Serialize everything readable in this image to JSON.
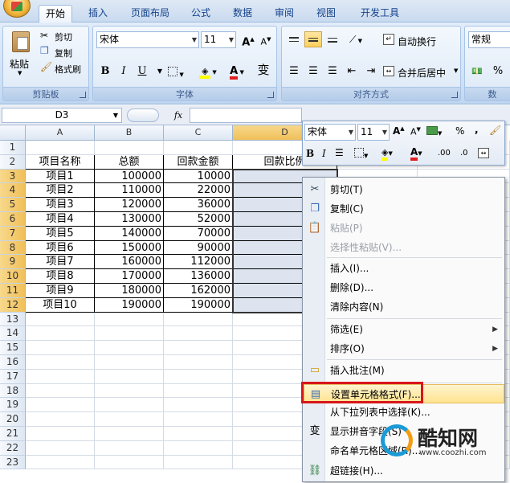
{
  "tabs": [
    "开始",
    "插入",
    "页面布局",
    "公式",
    "数据",
    "审阅",
    "视图",
    "开发工具"
  ],
  "ribbon": {
    "clipboard": {
      "label": "剪贴板",
      "paste": "粘贴",
      "cut": "剪切",
      "copy": "复制",
      "format_painter": "格式刷"
    },
    "font": {
      "label": "字体",
      "name": "宋体",
      "size": "11",
      "bold": "B",
      "italic": "I",
      "underline": "U",
      "grow": "A",
      "shrink": "A",
      "font_color": "A",
      "phonetic": "变"
    },
    "alignment": {
      "label": "对齐方式",
      "wrap": "自动换行",
      "merge": "合并后居中"
    },
    "number": {
      "label": "数",
      "format": "常规",
      "percent": "%"
    }
  },
  "formula_bar": {
    "name_box": "D3",
    "fx": "fx"
  },
  "columns": [
    "A",
    "B",
    "C",
    "D"
  ],
  "rows": [
    "1",
    "2",
    "3",
    "4",
    "5",
    "6",
    "7",
    "8",
    "9",
    "10",
    "11",
    "12",
    "13",
    "14",
    "15",
    "16",
    "17",
    "18",
    "19",
    "20",
    "21",
    "22",
    "23"
  ],
  "table": {
    "headers": [
      "项目名称",
      "总额",
      "回款金额",
      "回款比例"
    ],
    "data": [
      [
        "项目1",
        "100000",
        "10000"
      ],
      [
        "项目2",
        "110000",
        "22000"
      ],
      [
        "项目3",
        "120000",
        "36000"
      ],
      [
        "项目4",
        "130000",
        "52000"
      ],
      [
        "项目5",
        "140000",
        "70000"
      ],
      [
        "项目6",
        "150000",
        "90000"
      ],
      [
        "项目7",
        "160000",
        "112000"
      ],
      [
        "项目8",
        "170000",
        "136000"
      ],
      [
        "项目9",
        "180000",
        "162000"
      ],
      [
        "项目10",
        "190000",
        "190000"
      ]
    ]
  },
  "mini_toolbar": {
    "font": "宋体",
    "size": "11",
    "grow": "A",
    "shrink": "A",
    "percent": "%",
    "comma": ",",
    "bold": "B",
    "italic": "I",
    "font_color": "A",
    "inc_decimal": ".00",
    "dec_decimal": ".0"
  },
  "context_menu": [
    {
      "label": "剪切(T)",
      "icon": "scissors-icon"
    },
    {
      "label": "复制(C)",
      "icon": "copy-icon"
    },
    {
      "label": "粘贴(P)",
      "icon": "paste-icon",
      "disabled": true
    },
    {
      "label": "选择性粘贴(V)...",
      "disabled": true
    },
    {
      "label": "插入(I)..."
    },
    {
      "label": "删除(D)..."
    },
    {
      "label": "清除内容(N)"
    },
    {
      "label": "筛选(E)",
      "submenu": true
    },
    {
      "label": "排序(O)",
      "submenu": true
    },
    {
      "label": "插入批注(M)",
      "icon": "comment-icon"
    },
    {
      "label": "设置单元格格式(F)...",
      "icon": "format-cells-icon",
      "highlight": true
    },
    {
      "label": "从下拉列表中选择(K)..."
    },
    {
      "label": "显示拼音字段(S)",
      "icon": "phonetic-icon"
    },
    {
      "label": "命名单元格区域(R)..."
    },
    {
      "label": "超链接(H)...",
      "icon": "hyperlink-icon"
    }
  ],
  "watermark": {
    "brand": "酷知网",
    "url": "www.coozhi.com"
  }
}
